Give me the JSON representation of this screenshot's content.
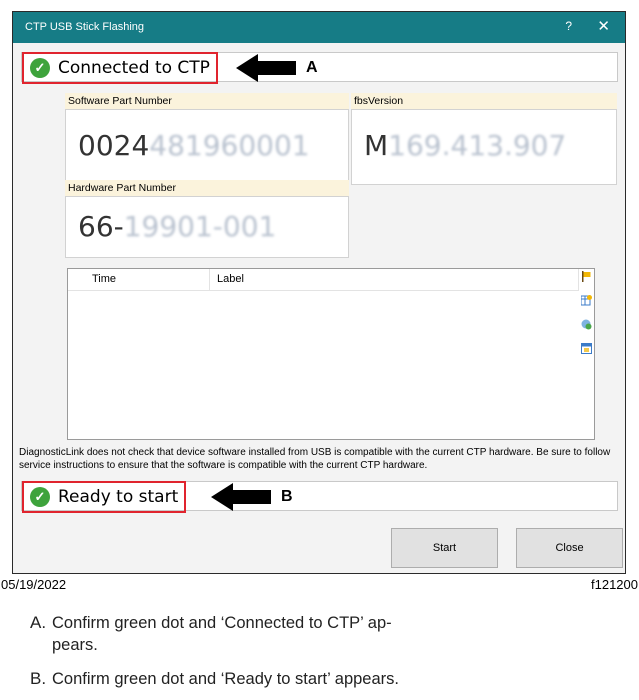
{
  "window": {
    "title": "CTP USB Stick Flashing",
    "help_glyph": "?",
    "close_glyph": "✕"
  },
  "status_connected": {
    "text": "Connected to CTP",
    "icon": "check-circle-icon",
    "color": "#3ea33c"
  },
  "status_ready": {
    "text": "Ready to start",
    "icon": "check-circle-icon",
    "color": "#3ea33c"
  },
  "callouts": {
    "a": "A",
    "b": "B"
  },
  "software_part": {
    "label": "Software Part Number",
    "value_visible": "0024",
    "value_blurred": "481960001"
  },
  "fbs_version": {
    "label": "fbsVersion",
    "value_visible": "M",
    "value_blurred": "169.413.907"
  },
  "hardware_part": {
    "label": "Hardware Part Number",
    "value_visible": "66-",
    "value_blurred": "19901-001"
  },
  "list": {
    "columns": [
      "Time",
      "Label"
    ],
    "side_icons": [
      "flag-icon",
      "table-star-icon",
      "globe-gear-icon",
      "calendar-icon"
    ]
  },
  "warning_text": "DiagnosticLink does not check that device software installed from USB is compatible with the current CTP hardware. Be sure to follow service instructions to ensure that the software is compatible with the current CTP hardware.",
  "buttons": {
    "start": "Start",
    "close": "Close"
  },
  "footer": {
    "date": "05/19/2022",
    "figure_id": "f121200"
  },
  "legend": [
    {
      "key": "A.",
      "line1": "Confirm green dot and ‘Connected to CTP’ ap-",
      "line2": "pears."
    },
    {
      "key": "B.",
      "line1": "Confirm green dot and ‘Ready to start’ appears."
    }
  ],
  "colors": {
    "titlebar": "#167c86",
    "highlight_border": "#e0242e",
    "field_label_bg": "#fbf3dc"
  }
}
